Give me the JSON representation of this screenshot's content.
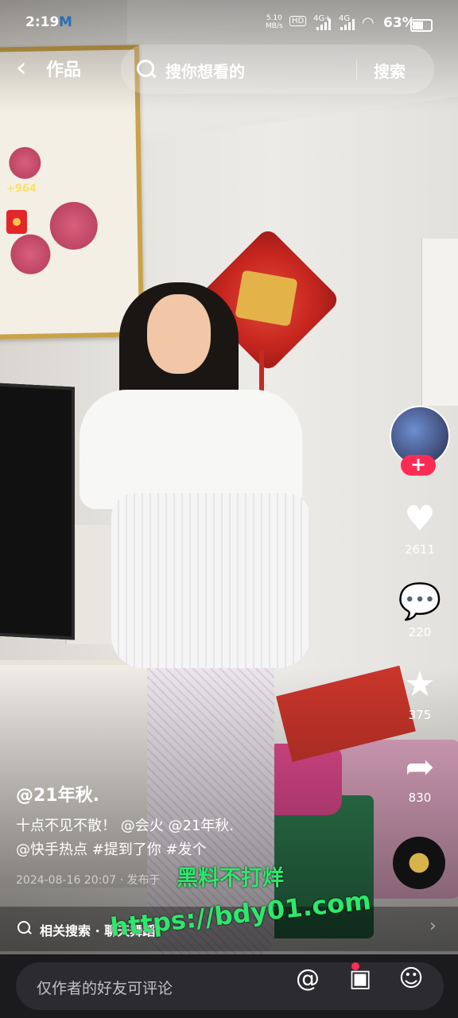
{
  "status_bar": {
    "time": "2:19",
    "carrier_mark": "M",
    "net_speed_top": "5.10",
    "net_speed_bottom": "MB/s",
    "hd": "HD",
    "sim1": "4G+",
    "sim2": "4G",
    "battery_text": "63%",
    "battery_level": 0.63
  },
  "header": {
    "back_icon": "chevron-left-icon",
    "title": "作品",
    "search_placeholder": "搜你想看的",
    "search_button": "搜索"
  },
  "reward": {
    "amount": "+964",
    "icon": "red-envelope-icon"
  },
  "actions": {
    "likes": "2611",
    "comments": "220",
    "favorites": "375",
    "shares": "830",
    "follow_symbol": "+"
  },
  "post": {
    "author": "@21年秋.",
    "caption_line1": "十点不见不散！ @会火 @21年秋.",
    "caption_line2": "@快手热点 #提到了你 #发个",
    "meta": "2024-08-16 20:07 · 发布于",
    "related_search": "相关搜索 · 聊天舞蹈"
  },
  "watermark": {
    "line1": "黑料不打烊",
    "line2": "https://bdy01.com"
  },
  "comment_bar": {
    "placeholder": "仅作者的好友可评论"
  },
  "colors": {
    "accent": "#fe2c55",
    "watermark": "#2ee86b",
    "bar_bg": "#1b1b1d"
  }
}
